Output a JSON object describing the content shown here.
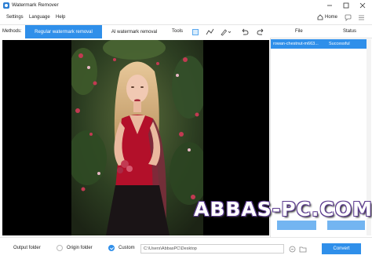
{
  "app": {
    "title": "Watermark Remover"
  },
  "menu": {
    "settings": "Settings",
    "language": "Language",
    "help": "Help",
    "home": "Home"
  },
  "toolbar": {
    "methods_label": "Methods:",
    "tab_regular": "Regular watermark removal",
    "tab_ai": "AI watermark removal",
    "tools_label": "Tools",
    "active_tab": "Regular watermark removal"
  },
  "file_list": {
    "columns": [
      "File",
      "Status"
    ],
    "rows": [
      {
        "file": "rowan-chestnut-m663...",
        "status": "Successful"
      }
    ]
  },
  "bottom": {
    "output_label": "Output folder",
    "origin_label": "Origin folder",
    "custom_label": "Custom",
    "selected_option": "Custom",
    "path_value": "C:\\Users\\AbbasPC\\Desktop",
    "convert_label": "Convert"
  },
  "overlay": {
    "watermark_text": "ABBAS-PC.COM"
  },
  "colors": {
    "accent": "#2f8fea",
    "preview_bg": "#000000",
    "watermark_outline": "#5b3a8e"
  },
  "icons": [
    "app-logo-icon",
    "minimize-icon",
    "maximize-icon",
    "close-icon",
    "home-icon",
    "chat-icon",
    "menu-icon",
    "rectangle-select-icon",
    "polyline-icon",
    "brush-icon",
    "undo-icon",
    "redo-icon",
    "checkmark-icon",
    "clear-path-icon",
    "folder-icon"
  ]
}
